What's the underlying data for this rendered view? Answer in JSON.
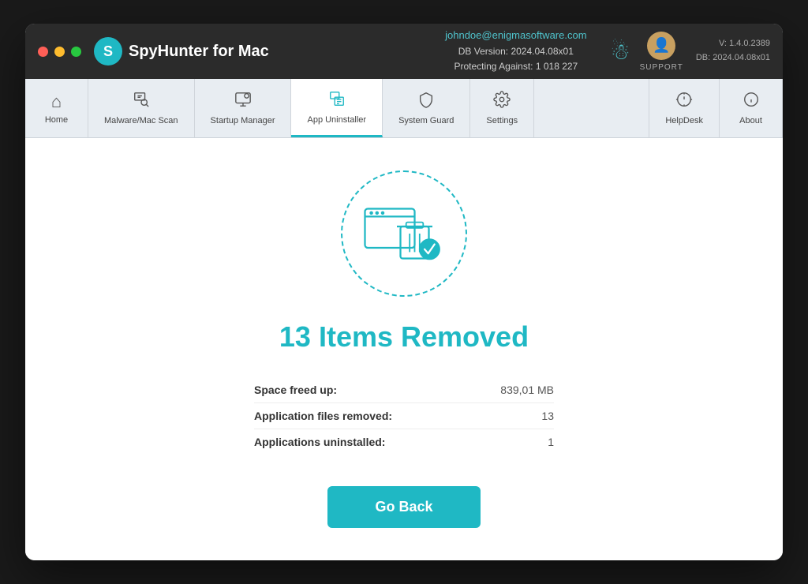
{
  "window": {
    "title": "SpyHunter for Mac"
  },
  "titlebar": {
    "logo_text": "SpyHunter",
    "logo_for": "FOR",
    "logo_mac": "Mac",
    "email": "johndoe@enigmasoftware.com",
    "db_version_label": "DB Version: 2024.04.08x01",
    "protecting_label": "Protecting Against: 1 018 227",
    "support_label": "SUPPORT",
    "version_label": "V: 1.4.0.2389",
    "db_label": "DB: 2024.04.08x01"
  },
  "navbar": {
    "items": [
      {
        "id": "home",
        "label": "Home",
        "icon": "⌂",
        "active": false
      },
      {
        "id": "malware-scan",
        "label": "Malware/Mac Scan",
        "icon": "🔍",
        "active": false
      },
      {
        "id": "startup-manager",
        "label": "Startup Manager",
        "icon": "⚙",
        "active": false
      },
      {
        "id": "app-uninstaller",
        "label": "App Uninstaller",
        "icon": "🗑",
        "active": true
      },
      {
        "id": "system-guard",
        "label": "System Guard",
        "icon": "🛡",
        "active": false
      },
      {
        "id": "settings",
        "label": "Settings",
        "icon": "⚙",
        "active": false
      }
    ],
    "helpdesk_label": "HelpDesk",
    "about_label": "About"
  },
  "main": {
    "items_removed_count": "13",
    "items_removed_label": "Items Removed",
    "stats": [
      {
        "label": "Space freed up:",
        "value": "839,01 MB"
      },
      {
        "label": "Application files removed:",
        "value": "13"
      },
      {
        "label": "Applications uninstalled:",
        "value": "1"
      }
    ],
    "go_back_label": "Go Back"
  }
}
